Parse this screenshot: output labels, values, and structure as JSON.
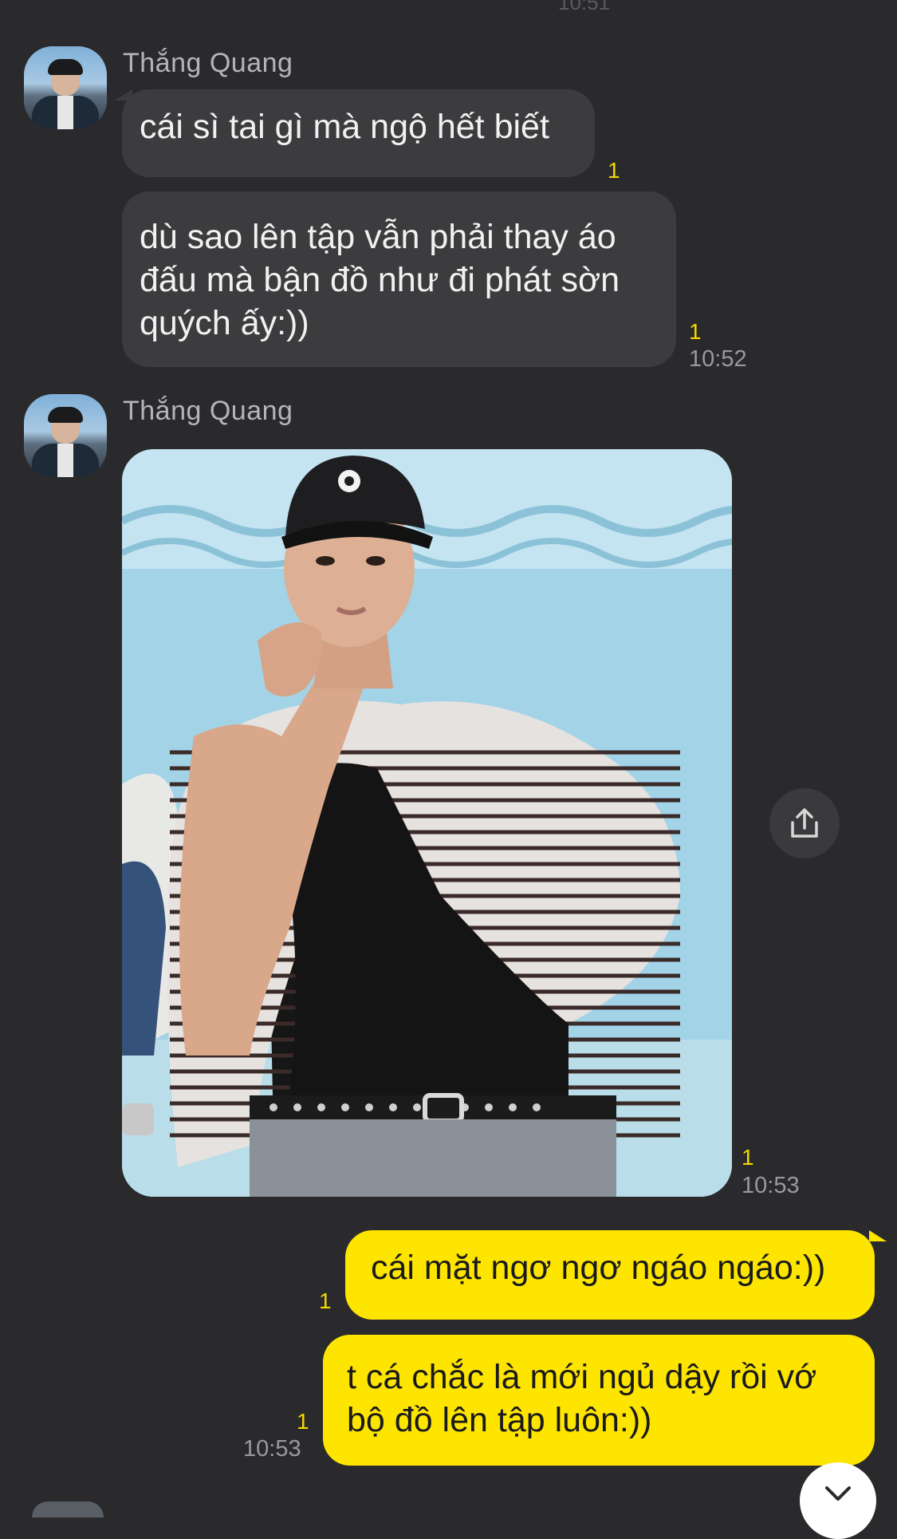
{
  "header": {
    "prev_time_partial": "10:51"
  },
  "messages": [
    {
      "sender": "Thắng Quang",
      "lines": [
        "cái sì tai gì mà ngộ hết biết"
      ],
      "unread": "1"
    },
    {
      "lines": [
        "dù sao lên tập vẫn phải thay áo",
        "đấu mà bận đồ như đi phát sờn",
        "quých ấy:))"
      ],
      "unread": "1",
      "time": "10:52"
    },
    {
      "sender": "Thắng Quang",
      "image": "photo of man in black cap and striped shirt",
      "unread": "1",
      "time": "10:53"
    },
    {
      "outgoing": true,
      "lines": [
        "cái mặt ngơ ngơ ngáo ngáo:))"
      ],
      "unread": "1"
    },
    {
      "outgoing": true,
      "lines": [
        "t cá chắc là mới ngủ dậy rồi vớ",
        "bộ đồ lên tập luôn:))"
      ],
      "unread": "1",
      "time": "10:53"
    }
  ],
  "icons": {
    "share": "share-icon",
    "scroll_down": "chevron-down-icon"
  },
  "colors": {
    "background": "#2a2a2c",
    "incoming_bubble": "#3c3c3f",
    "outgoing_bubble": "#fde500",
    "unread": "#f4d800"
  }
}
